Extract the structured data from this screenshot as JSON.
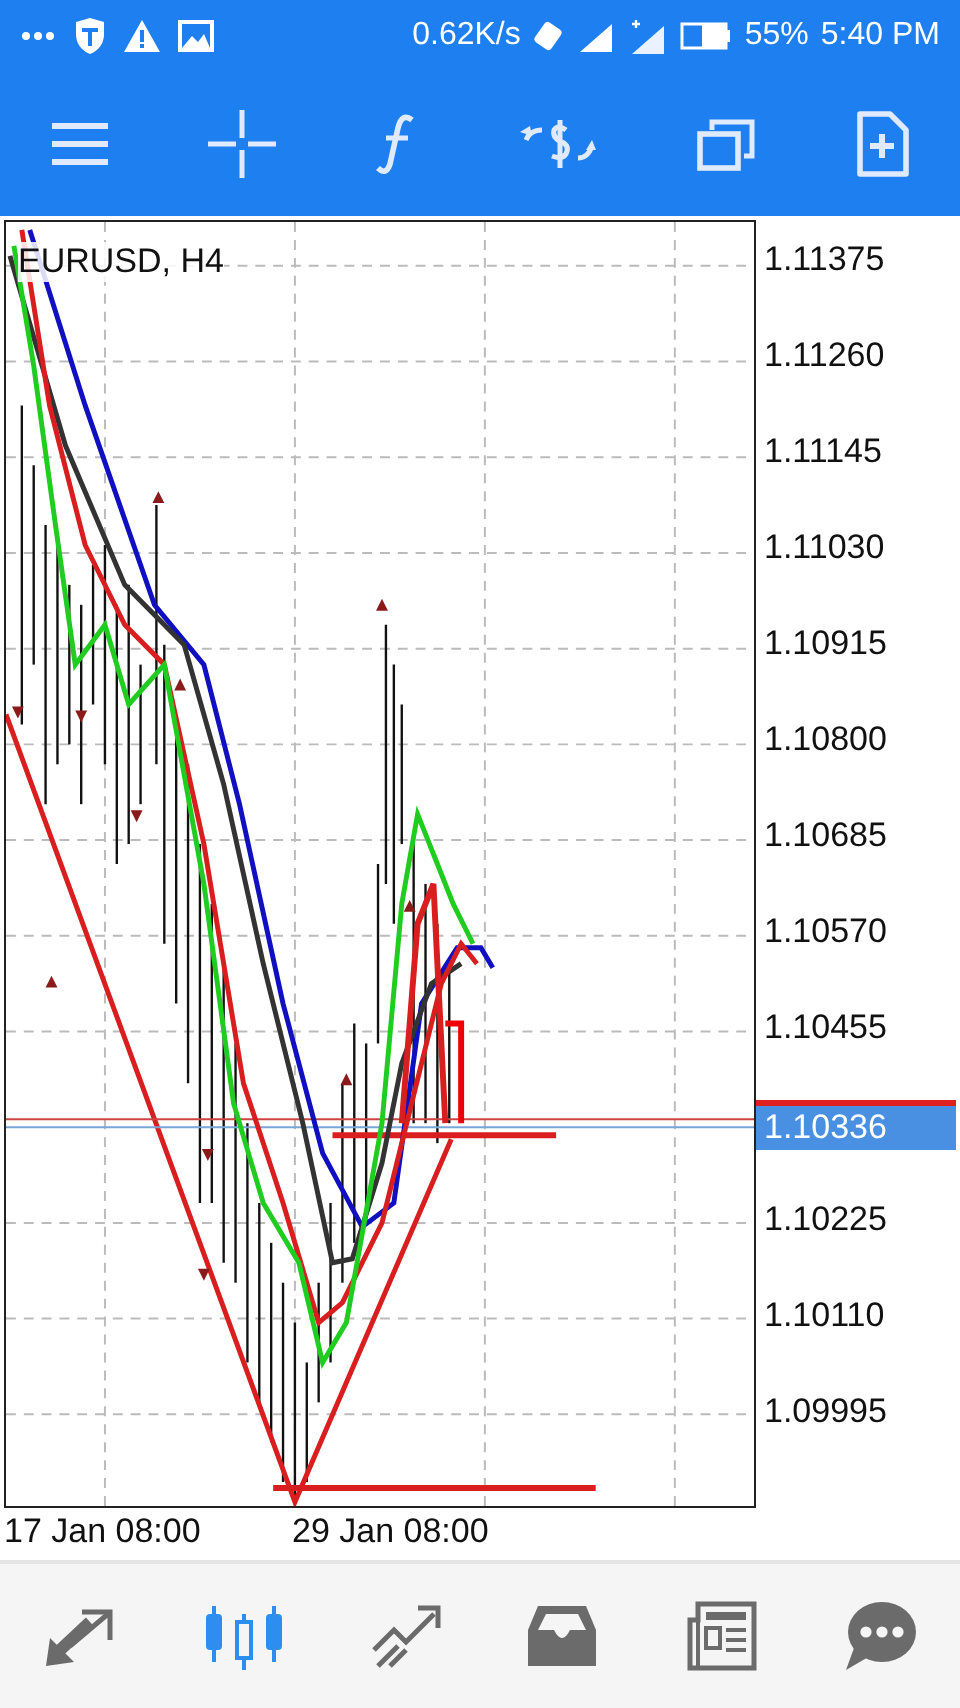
{
  "status_bar": {
    "speed": "0.62K/s",
    "battery": "55%",
    "time": "5:40 PM"
  },
  "chart": {
    "symbol": "EURUSD, H4",
    "price_labels": [
      "1.11375",
      "1.11260",
      "1.11145",
      "1.11030",
      "1.10915",
      "1.10800",
      "1.10685",
      "1.10570",
      "1.10455",
      "1.10225",
      "1.10110",
      "1.09995"
    ],
    "current_price": "1.10336",
    "time_labels": [
      "17 Jan 08:00",
      "29 Jan 08:00"
    ]
  },
  "bottom_nav": [
    {
      "kind": "quotes",
      "selected": false
    },
    {
      "kind": "chart",
      "selected": true
    },
    {
      "kind": "trade",
      "selected": false
    },
    {
      "kind": "history",
      "selected": false
    },
    {
      "kind": "news",
      "selected": false
    },
    {
      "kind": "chat",
      "selected": false
    }
  ]
}
